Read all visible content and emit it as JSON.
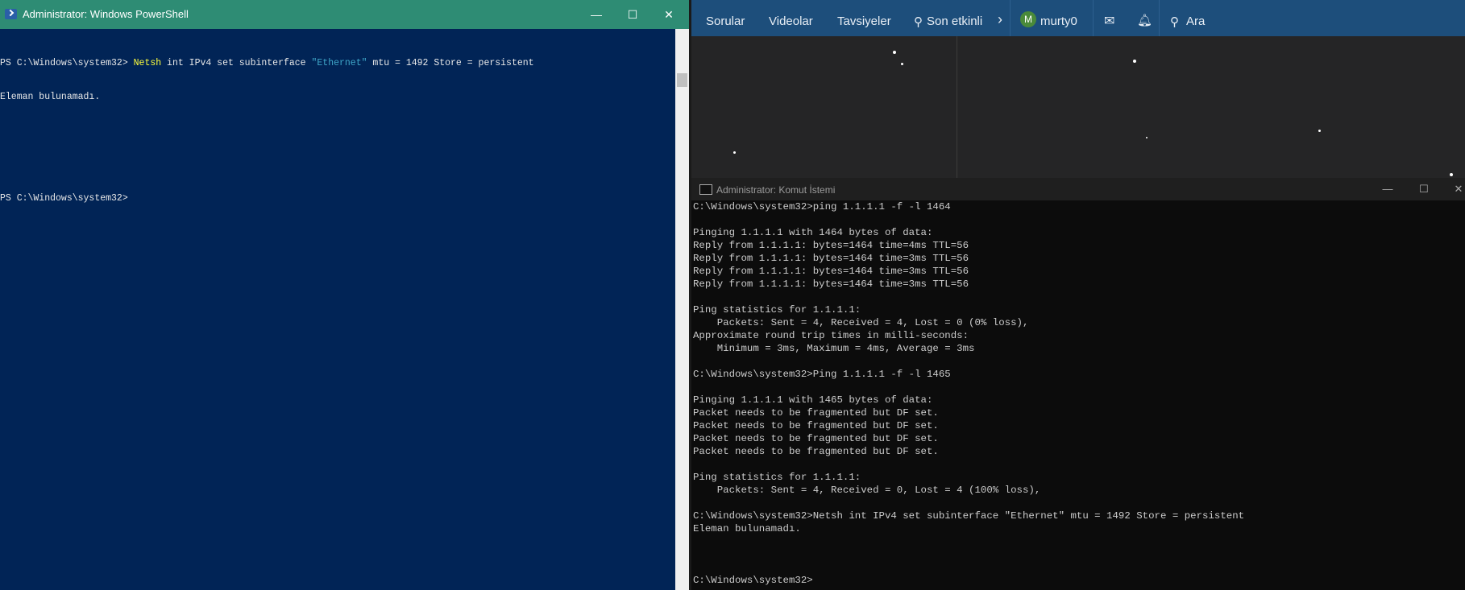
{
  "powershell": {
    "title": "Administrator: Windows PowerShell",
    "lines": [
      {
        "prompt": "PS C:\\Windows\\system32> ",
        "cmd": "Netsh",
        "rest": " int IPv4 set subinterface ",
        "arg": "\"Ethernet\"",
        "tail": " mtu = 1492 Store = persistent"
      },
      {
        "text": "Eleman bulunamadı."
      },
      {
        "text": ""
      },
      {
        "text": ""
      },
      {
        "text": "PS C:\\Windows\\system32>"
      }
    ],
    "minimize": "—",
    "maximize": "☐",
    "close": "✕"
  },
  "web_nav": {
    "items": [
      "Sorular",
      "Videolar",
      "Tavsiyeler",
      "Son etkinli"
    ],
    "user": "murty0",
    "avatar_letter": "M",
    "search_label": "Ara"
  },
  "cmd": {
    "title": "Administrator: Komut İstemi",
    "lines": [
      "C:\\Windows\\system32>ping 1.1.1.1 -f -l 1464",
      "",
      "Pinging 1.1.1.1 with 1464 bytes of data:",
      "Reply from 1.1.1.1: bytes=1464 time=4ms TTL=56",
      "Reply from 1.1.1.1: bytes=1464 time=3ms TTL=56",
      "Reply from 1.1.1.1: bytes=1464 time=3ms TTL=56",
      "Reply from 1.1.1.1: bytes=1464 time=3ms TTL=56",
      "",
      "Ping statistics for 1.1.1.1:",
      "    Packets: Sent = 4, Received = 4, Lost = 0 (0% loss),",
      "Approximate round trip times in milli-seconds:",
      "    Minimum = 3ms, Maximum = 4ms, Average = 3ms",
      "",
      "C:\\Windows\\system32>Ping 1.1.1.1 -f -l 1465",
      "",
      "Pinging 1.1.1.1 with 1465 bytes of data:",
      "Packet needs to be fragmented but DF set.",
      "Packet needs to be fragmented but DF set.",
      "Packet needs to be fragmented but DF set.",
      "Packet needs to be fragmented but DF set.",
      "",
      "Ping statistics for 1.1.1.1:",
      "    Packets: Sent = 4, Received = 0, Lost = 4 (100% loss),",
      "",
      "C:\\Windows\\system32>Netsh int IPv4 set subinterface \"Ethernet\" mtu = 1492 Store = persistent",
      "Eleman bulunamadı.",
      "",
      "",
      "",
      "C:\\Windows\\system32>"
    ],
    "minimize": "—",
    "maximize": "☐",
    "close": "✕"
  }
}
